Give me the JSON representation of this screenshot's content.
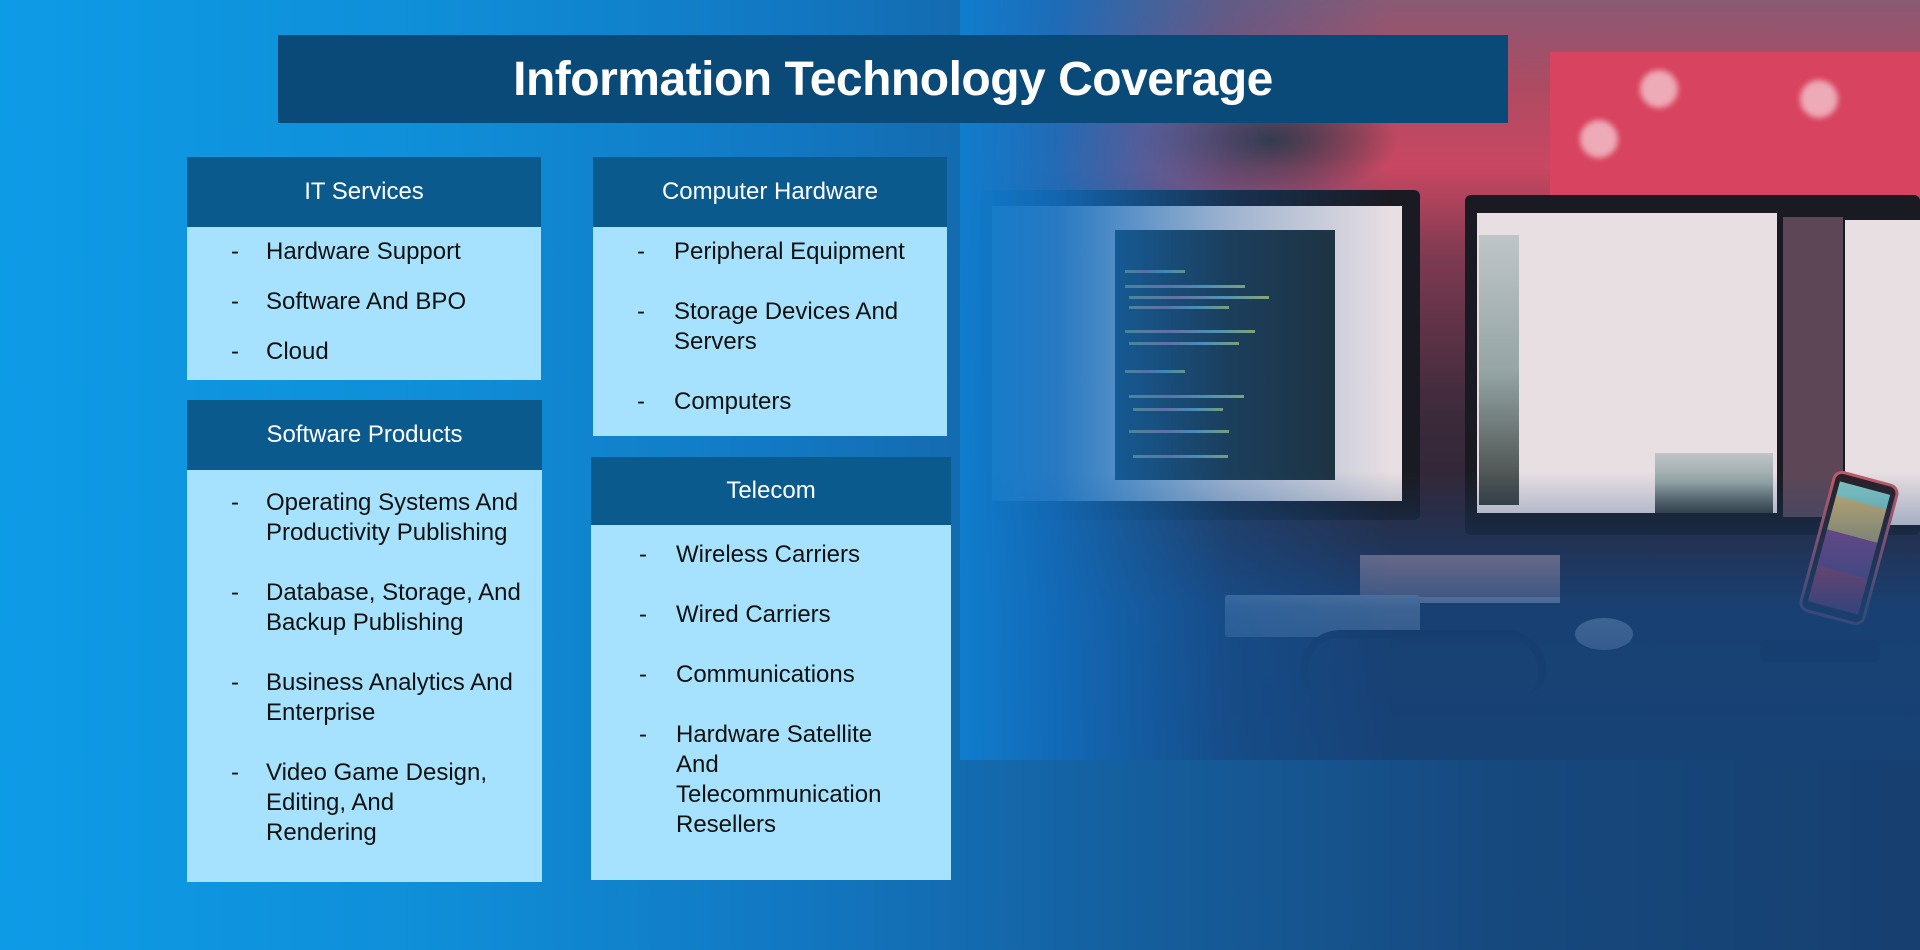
{
  "title": "Information Technology Coverage",
  "colors": {
    "background_left": "#0e9be6",
    "background_right": "#173f70",
    "title_bar": "#0a4a78",
    "card_header": "#0b5a8e",
    "card_body": "#a6e2fd"
  },
  "bullet_glyph": "-",
  "cards": [
    {
      "id": "it-services",
      "heading": "IT Services",
      "items": [
        "Hardware Support",
        "Software And BPO",
        "Cloud"
      ]
    },
    {
      "id": "software-products",
      "heading": "Software Products",
      "items": [
        "Operating Systems And Productivity Publishing",
        "Database, Storage, And Backup Publishing",
        "Business Analytics And Enterprise",
        "Video Game Design, Editing, And Rendering"
      ]
    },
    {
      "id": "computer-hardware",
      "heading": "Computer Hardware",
      "items": [
        "Peripheral Equipment",
        "Storage Devices And Servers",
        "Computers"
      ]
    },
    {
      "id": "telecom",
      "heading": "Telecom",
      "items": [
        "Wireless Carriers",
        "Wired Carriers",
        "Communications",
        "Hardware Satellite And Telecommunication Resellers"
      ]
    }
  ],
  "background_image": {
    "description": "desk with dual monitors showing code, keyboard, headphones, mouse and phone on stand"
  }
}
